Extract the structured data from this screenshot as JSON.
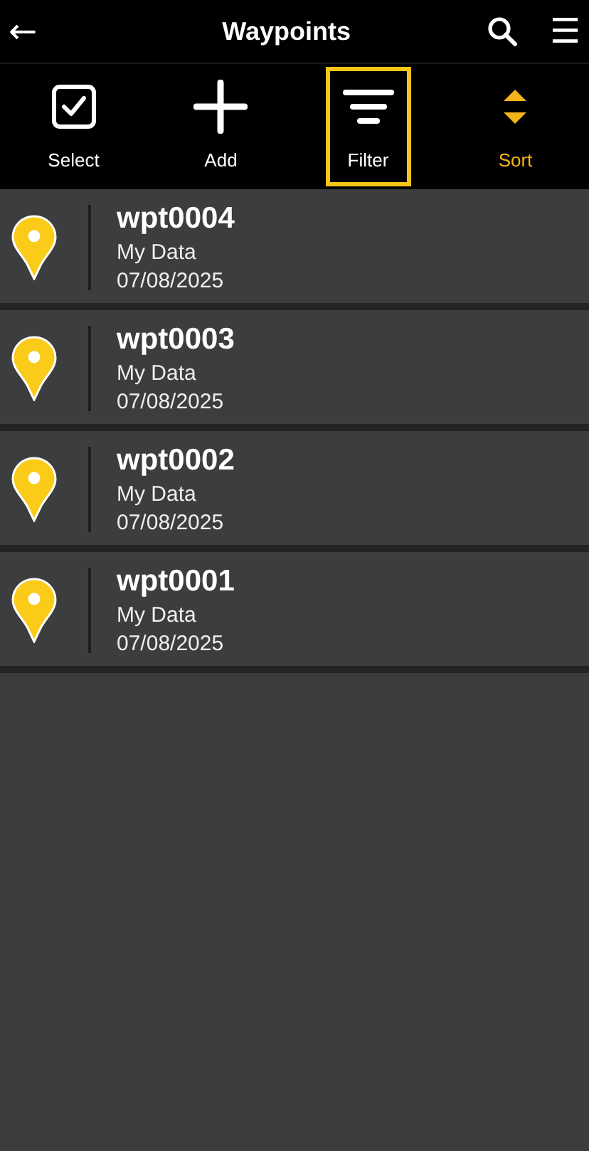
{
  "header": {
    "back": "←",
    "title": "Waypoints",
    "menu": "☰"
  },
  "toolbar": [
    {
      "kind": "select",
      "label": "Select",
      "active": false,
      "focused": false
    },
    {
      "kind": "add",
      "label": "Add",
      "active": false,
      "focused": false
    },
    {
      "kind": "filter",
      "label": "Filter",
      "active": false,
      "focused": true
    },
    {
      "kind": "sort",
      "label": "Sort",
      "active": true,
      "focused": false
    }
  ],
  "waypoints": [
    {
      "name": "wpt0004",
      "source": "My Data",
      "date": "07/08/2025"
    },
    {
      "name": "wpt0003",
      "source": "My Data",
      "date": "07/08/2025"
    },
    {
      "name": "wpt0002",
      "source": "My Data",
      "date": "07/08/2025"
    },
    {
      "name": "wpt0001",
      "source": "My Data",
      "date": "07/08/2025"
    }
  ]
}
